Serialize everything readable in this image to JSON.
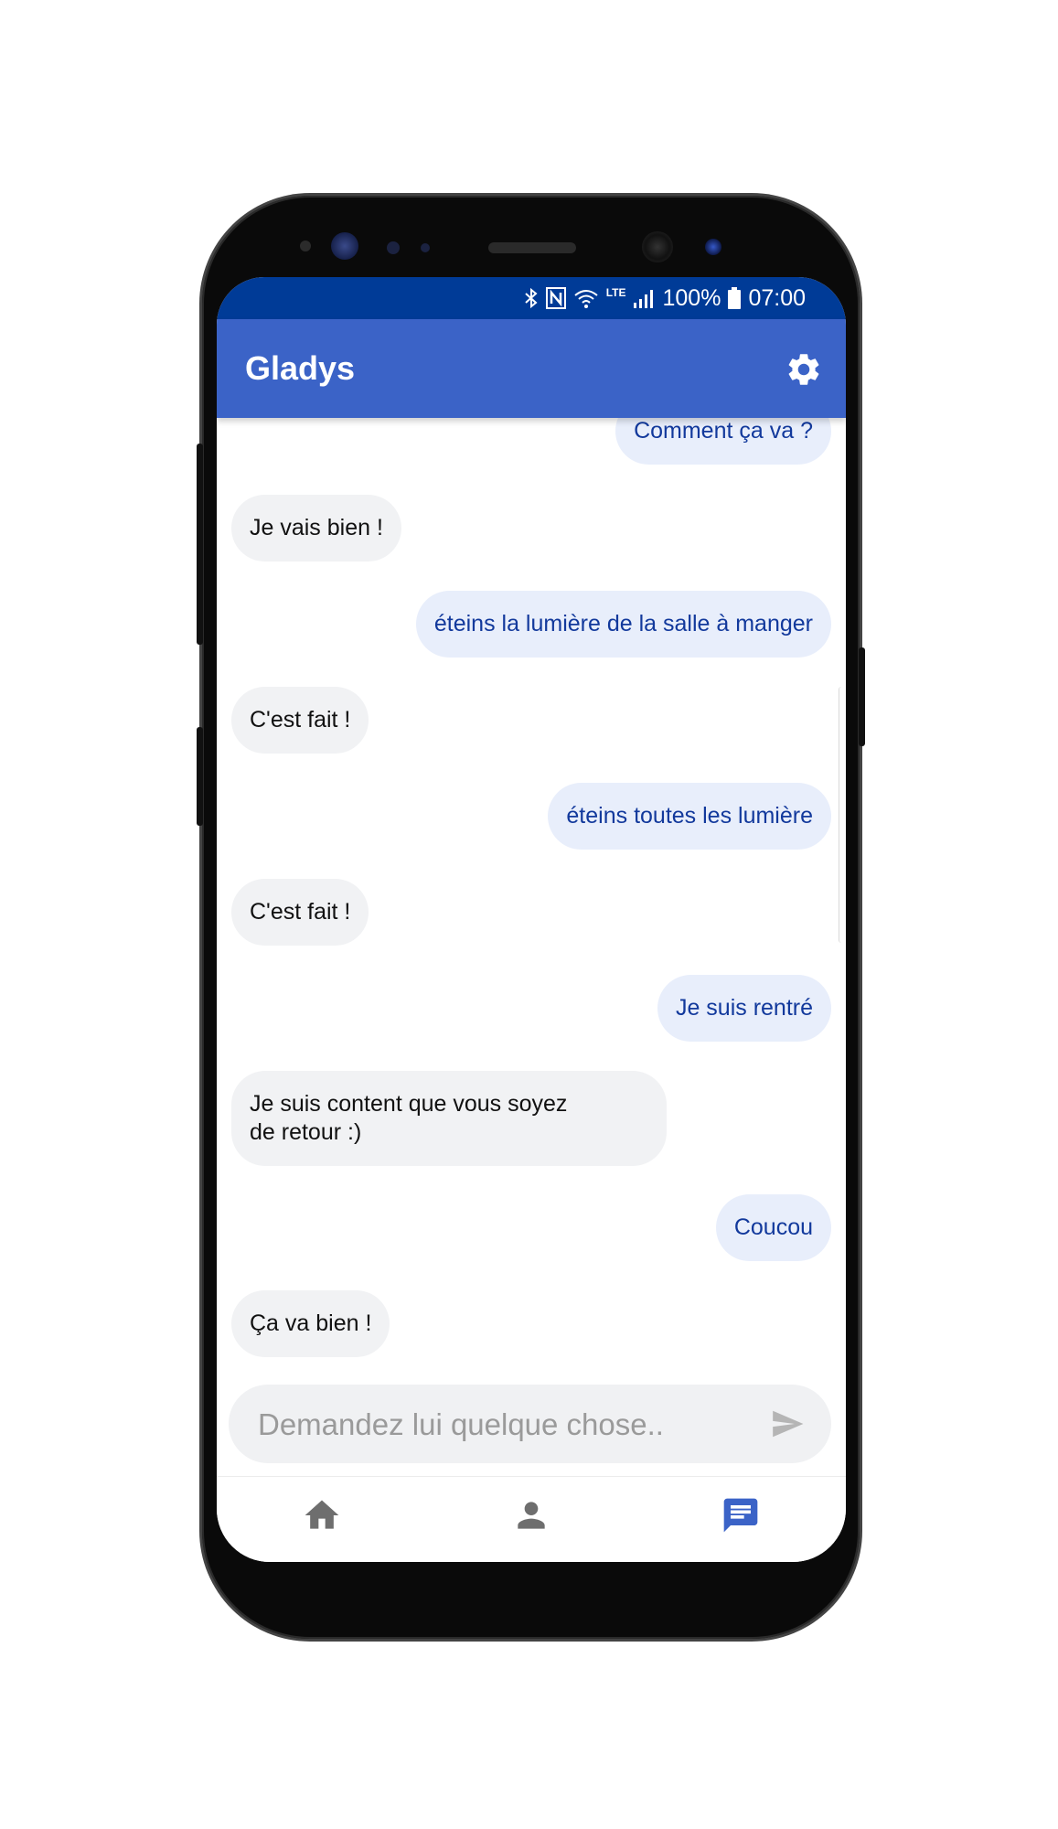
{
  "status_bar": {
    "battery": "100%",
    "time": "07:00",
    "network": "LTE",
    "icons": [
      "bluetooth-icon",
      "nfc-icon",
      "wifi-icon",
      "signal-icon",
      "battery-icon"
    ]
  },
  "app_bar": {
    "title": "Gladys",
    "settings_icon": "gear-icon"
  },
  "messages": [
    {
      "from": "user",
      "text": "Comment ça va ?"
    },
    {
      "from": "bot",
      "text": "Je vais bien !"
    },
    {
      "from": "user",
      "text": "éteins la lumière de la salle à manger"
    },
    {
      "from": "bot",
      "text": "C'est fait !"
    },
    {
      "from": "user",
      "text": "éteins toutes les lumière"
    },
    {
      "from": "bot",
      "text": "C'est fait !"
    },
    {
      "from": "user",
      "text": "Je suis rentré"
    },
    {
      "from": "bot",
      "text": "Je suis content que vous soyez\nde retour :)"
    },
    {
      "from": "user",
      "text": "Coucou"
    },
    {
      "from": "bot",
      "text": "Ça va bien !"
    }
  ],
  "input": {
    "placeholder": "Demandez lui quelque chose..",
    "value": "",
    "send_icon": "send-icon"
  },
  "bottom_nav": {
    "items": [
      {
        "icon": "home-icon",
        "active": false
      },
      {
        "icon": "person-icon",
        "active": false
      },
      {
        "icon": "chat-icon",
        "active": true
      }
    ]
  },
  "colors": {
    "status_bar": "#003b97",
    "app_bar": "#3b63c7",
    "user_bubble": "#e8eefb",
    "user_text": "#12399c",
    "bot_bubble": "#f1f2f4",
    "nav_active": "#3b63c7",
    "nav_inactive": "#6e6e6e"
  }
}
